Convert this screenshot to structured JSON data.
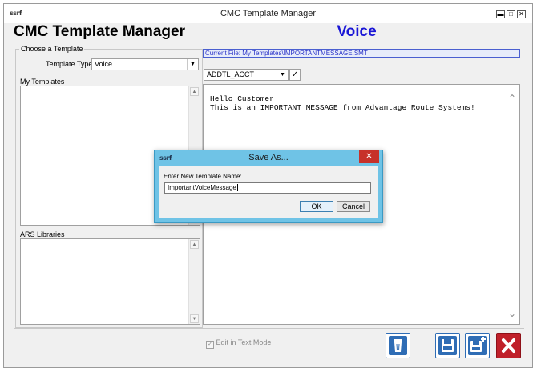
{
  "window": {
    "title": "CMC Template Manager",
    "icon_text": "ssrf",
    "controls": {
      "minimize": "▬",
      "maximize": "□",
      "close": "✕"
    }
  },
  "header": {
    "app_title": "CMC Template Manager",
    "mode": "Voice"
  },
  "choose_template": {
    "group_label": "Choose a Template",
    "template_type_label": "Template Type",
    "template_type_value": "Voice"
  },
  "my_templates": {
    "label": "My Templates"
  },
  "ars_libraries": {
    "label": "ARS Libraries"
  },
  "current_file": "Current File: My Templates\\IMPORTANTMESSAGE.SMT",
  "field_selector": {
    "value": "ADDTL_ACCT",
    "apply": "✓"
  },
  "editor": {
    "content": "Hello Customer\nThis is an IMPORTANT MESSAGE from Advantage Route Systems!"
  },
  "bottom": {
    "edit_text_mode": "Edit in Text Mode",
    "checked": true
  },
  "toolbar": {
    "icons": [
      "trash-icon",
      "save-icon",
      "save-new-icon",
      "close-icon"
    ],
    "accent": "#2f6db5",
    "danger": "#c0202a"
  },
  "dialog": {
    "title": "Save As...",
    "icon_text": "ssrf",
    "close": "✕",
    "prompt": "Enter New Template Name:",
    "input_value": "ImportantVoiceMessage",
    "ok": "OK",
    "cancel": "Cancel"
  }
}
